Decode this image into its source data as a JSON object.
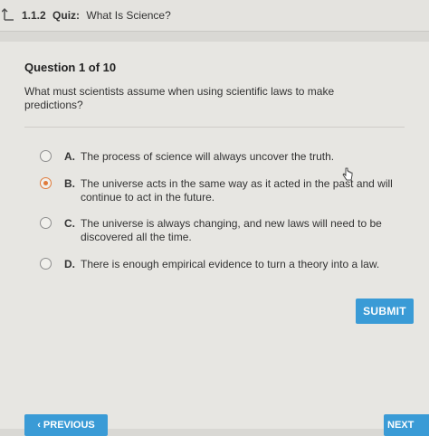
{
  "header": {
    "quiz_number": "1.1.2",
    "quiz_label": "Quiz:",
    "quiz_title": "What Is Science?"
  },
  "question": {
    "heading": "Question 1 of 10",
    "text": "What must scientists assume when using scientific laws to make predictions?"
  },
  "options": [
    {
      "letter": "A.",
      "text": "The process of science will always uncover the truth.",
      "selected": false
    },
    {
      "letter": "B.",
      "text": "The universe acts in the same way as it acted in the past and will continue to act in the future.",
      "selected": true
    },
    {
      "letter": "C.",
      "text": "The universe is always changing, and new laws will need to be discovered all the time.",
      "selected": false
    },
    {
      "letter": "D.",
      "text": "There is enough empirical evidence to turn a theory into a law.",
      "selected": false
    }
  ],
  "buttons": {
    "submit": "SUBMIT",
    "previous": "‹ PREVIOUS",
    "next": "NEXT"
  },
  "colors": {
    "accent": "#3a9bd6",
    "selected_radio": "#e07a3a"
  }
}
